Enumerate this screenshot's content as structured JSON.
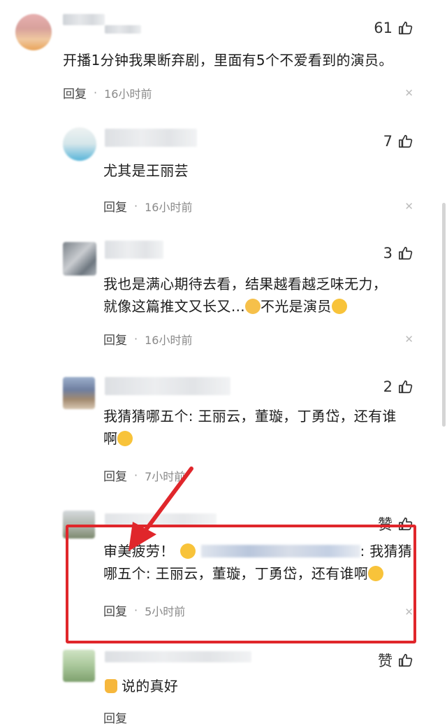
{
  "comments": [
    {
      "likes": "61",
      "text": "开播1分钟我果断弃剧，里面有5个不爱看到的演员。",
      "reply": "回复",
      "time": "16小时前"
    },
    {
      "likes": "7",
      "text": "尤其是王丽芸",
      "reply": "回复",
      "time": "16小时前"
    },
    {
      "likes": "3",
      "text_line1": "我也是满心期待去看，结果越看越乏味无力，",
      "text_line2": "就像这篇推文又长又…",
      "text_line2b": "不光是演员",
      "reply": "回复",
      "time": "16小时前"
    },
    {
      "likes": "2",
      "text_line1": "我猜猜哪五个: 王丽云，董璇，丁勇岱，还有谁",
      "text_line2": "啊",
      "reply": "回复",
      "time": "7小时前"
    },
    {
      "likes": "赞",
      "text_part1": "审美疲劳！",
      "text_part2": ": 我猜猜",
      "text_line2": "哪五个: 王丽云，董璇，丁勇岱，还有谁啊",
      "reply": "回复",
      "time": "5小时前"
    },
    {
      "likes": "赞",
      "text": "说的真好",
      "reply": "回复"
    }
  ],
  "colors": {
    "highlight": "#e0262b",
    "arrow": "#e0262b",
    "like": "#333333"
  },
  "icons": {
    "like": "thumbs-up-icon",
    "close": "close-icon"
  }
}
